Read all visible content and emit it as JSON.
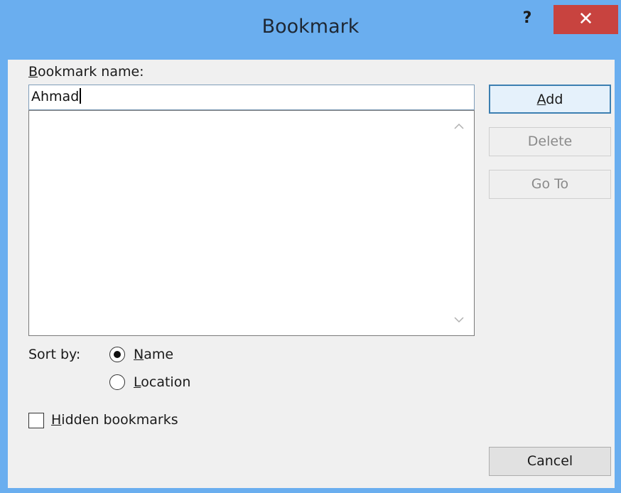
{
  "window": {
    "title": "Bookmark",
    "help_label": "?",
    "close_label": "✕"
  },
  "form": {
    "name_label_key": "B",
    "name_label_rest": "ookmark name:",
    "name_value": "Ahmad",
    "bookmarks": []
  },
  "buttons": {
    "add_key": "A",
    "add_rest": "dd",
    "delete": "Delete",
    "goto": "Go To",
    "cancel": "Cancel",
    "delete_enabled": false,
    "goto_enabled": false
  },
  "sort": {
    "label": "Sort by:",
    "name_key": "N",
    "name_rest": "ame",
    "location_key": "L",
    "location_rest": "ocation",
    "selected": "Name"
  },
  "hidden": {
    "key": "H",
    "rest": "idden bookmarks",
    "checked": false
  },
  "icons": {
    "scroll_up": "chevron-up-icon",
    "scroll_down": "chevron-down-icon"
  },
  "colors": {
    "titlebar": "#6aaeef",
    "close": "#c8433f",
    "client": "#f0f0f0"
  }
}
